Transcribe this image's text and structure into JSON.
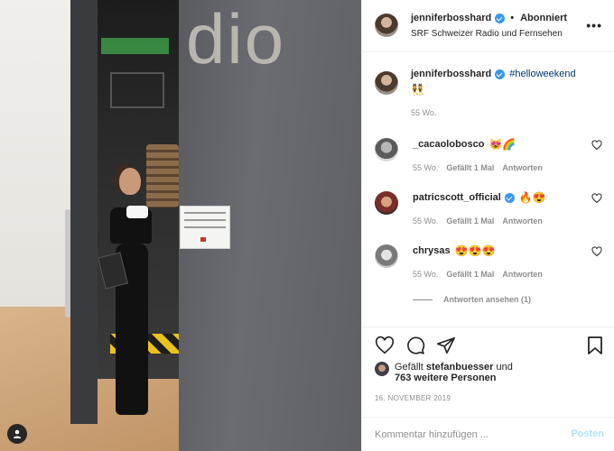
{
  "photo": {
    "sign_text": "dio"
  },
  "header": {
    "username": "jenniferbosshard",
    "follow_label": "Abonniert",
    "separator": "•",
    "location": "SRF Schweizer Radio und Fernsehen",
    "more_label": "•••"
  },
  "caption": {
    "username": "jenniferbosshard",
    "hashtag": "#helloweekend",
    "emoji": "👯",
    "time": "55 Wo."
  },
  "comments": [
    {
      "username": "_cacaolobosco",
      "emoji": "😻🌈",
      "time": "55 Wo.",
      "likes": "Gefällt 1 Mal",
      "reply": "Antworten"
    },
    {
      "username": "patricscott_official",
      "emoji": "🔥😍",
      "time": "55 Wo.",
      "likes": "Gefällt 1 Mal",
      "reply": "Antworten"
    },
    {
      "username": "chrysas",
      "emoji": "😍😍😍",
      "time": "55 Wo.",
      "likes": "Gefällt 1 Mal",
      "reply": "Antworten"
    }
  ],
  "view_replies": "Antworten ansehen (1)",
  "likes": {
    "prefix": "Gefällt",
    "user": "stefanbuesser",
    "mid": "und",
    "count_text": "763 weitere Personen"
  },
  "date": "16. NOVEMBER 2019",
  "add_comment": {
    "placeholder": "Kommentar hinzufügen ...",
    "post_label": "Posten"
  }
}
